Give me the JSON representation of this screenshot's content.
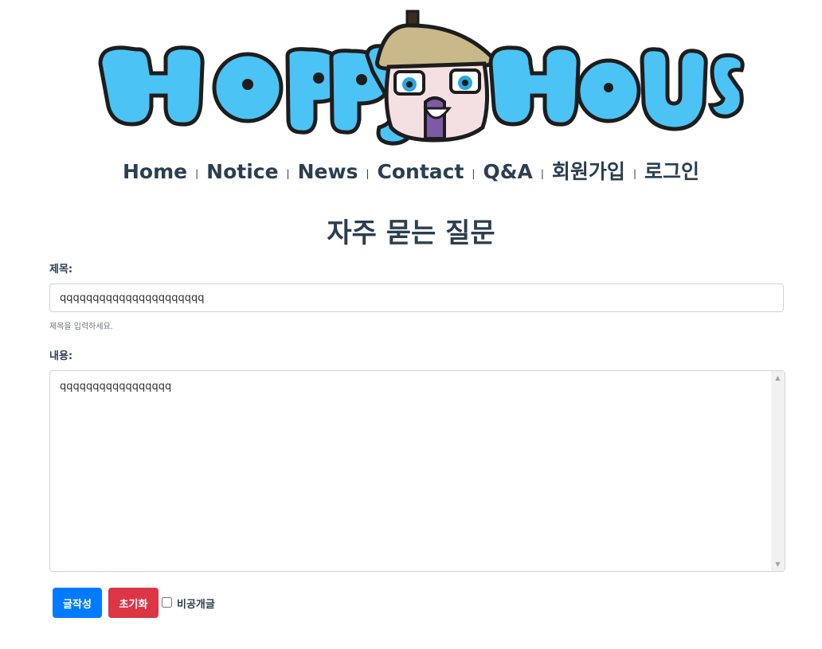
{
  "logo": {
    "text": "HappyHouse"
  },
  "nav": {
    "items": [
      "Home",
      "Notice",
      "News",
      "Contact",
      "Q&A",
      "회원가입",
      "로그인"
    ],
    "separator": "|"
  },
  "page": {
    "title": "자주 묻는 질문"
  },
  "form": {
    "subject_label": "제목:",
    "subject_value": "qqqqqqqqqqqqqqqqqqqqqq",
    "subject_help": "제목을 입력하세요.",
    "content_label": "내용:",
    "content_value": "qqqqqqqqqqqqqqqqq",
    "submit_label": "글작성",
    "reset_label": "초기화",
    "private_label": "비공개글",
    "private_checked": false
  },
  "colors": {
    "primary": "#007bff",
    "danger": "#dc3545",
    "text": "#2c3e50",
    "logo_blue": "#4cc3f5",
    "logo_outline": "#1d1d1d"
  }
}
